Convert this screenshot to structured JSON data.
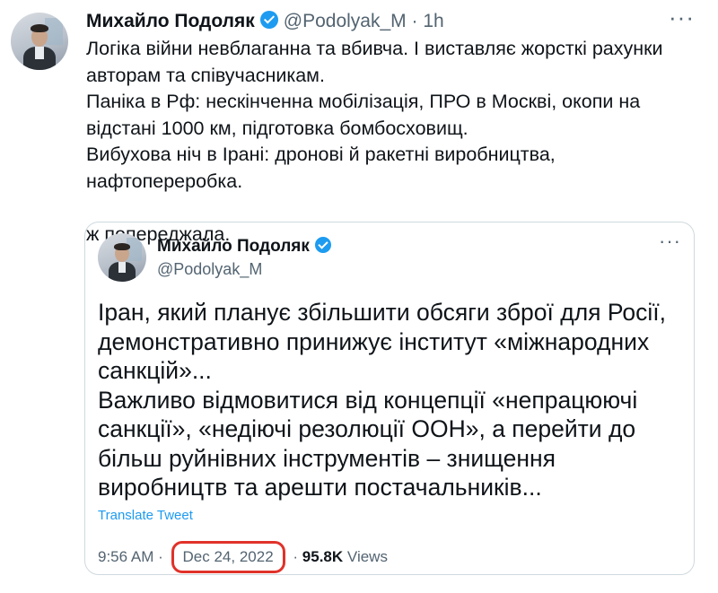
{
  "tweet": {
    "author_name": "Михайло Подоляк",
    "handle": "@Podolyak_M",
    "separator": "·",
    "time_ago": "1h",
    "more": "···",
    "lines": [
      "Логіка війни невблаганна та вбивча. І виставляє жорсткі рахунки авторам та співучасникам.",
      "Паніка в Рф: нескінченна мобілізація, ПРО в Москві, окопи на відстані 1000 км, підготовка бомбосховищ.",
      "Вибухова ніч в Ірані: дронові й ракетні виробництва, нафтопереробка."
    ],
    "flag_icon": "ukraine-flag-icon",
    "flag_line": "ж попереджала."
  },
  "quoted": {
    "author_name": "Михайло Подоляк",
    "handle": "@Podolyak_M",
    "more": "···",
    "paragraphs": [
      "Іран, який планує збільшити обсяги зброї для Росії, демонстративно принижує інститут «міжнародних санкцій»...",
      "Важливо відмовитися від концепції «непрацюючі санкції», «недіючі резолюції ООН», а перейти до більш руйнівних інструментів – знищення виробництв та арешти постачальників..."
    ],
    "translate_label": "Translate Tweet",
    "time": "9:56 AM",
    "dot": "·",
    "date": "Dec 24, 2022",
    "views_count": "95.8K",
    "views_label": "Views"
  },
  "colors": {
    "verified": "#1d9bf0",
    "highlight": "#e0322a",
    "muted": "#536471"
  }
}
